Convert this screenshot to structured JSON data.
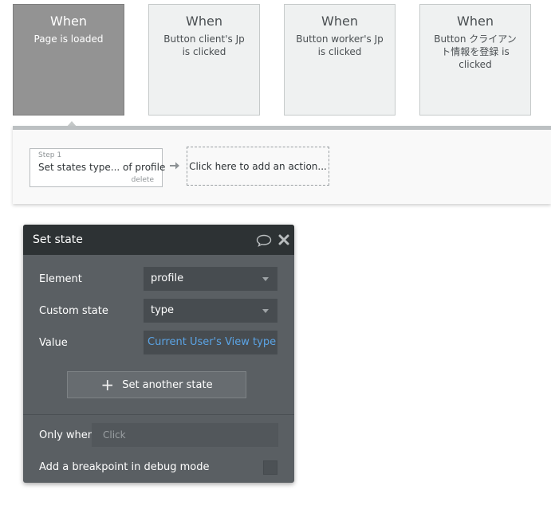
{
  "events": [
    {
      "when": "When",
      "description": "Page is loaded",
      "active": true
    },
    {
      "when": "When",
      "description": "Button client's Jp is clicked",
      "active": false
    },
    {
      "when": "When",
      "description": "Button worker's Jp is clicked",
      "active": false
    },
    {
      "when": "When",
      "description": "Button クライアント情報を登録 is clicked",
      "active": false
    }
  ],
  "workflow": {
    "step": {
      "number_label": "Step 1",
      "title": "Set states type... of profile",
      "delete_label": "delete"
    },
    "add_action_label": "Click here to add an action..."
  },
  "panel": {
    "title": "Set state",
    "element": {
      "label": "Element",
      "value": "profile"
    },
    "custom_state": {
      "label": "Custom state",
      "value": "type"
    },
    "value_field": {
      "label": "Value",
      "value": "Current User's View type"
    },
    "set_another_label": "Set another state",
    "only_when": {
      "label": "Only when",
      "placeholder": "Click"
    },
    "breakpoint_label": "Add a breakpoint in debug mode"
  },
  "colors": {
    "panel_bg": "#5a5f63",
    "panel_header": "#2d3234",
    "link_blue": "#5ba4e5",
    "active_event": "#939393"
  }
}
